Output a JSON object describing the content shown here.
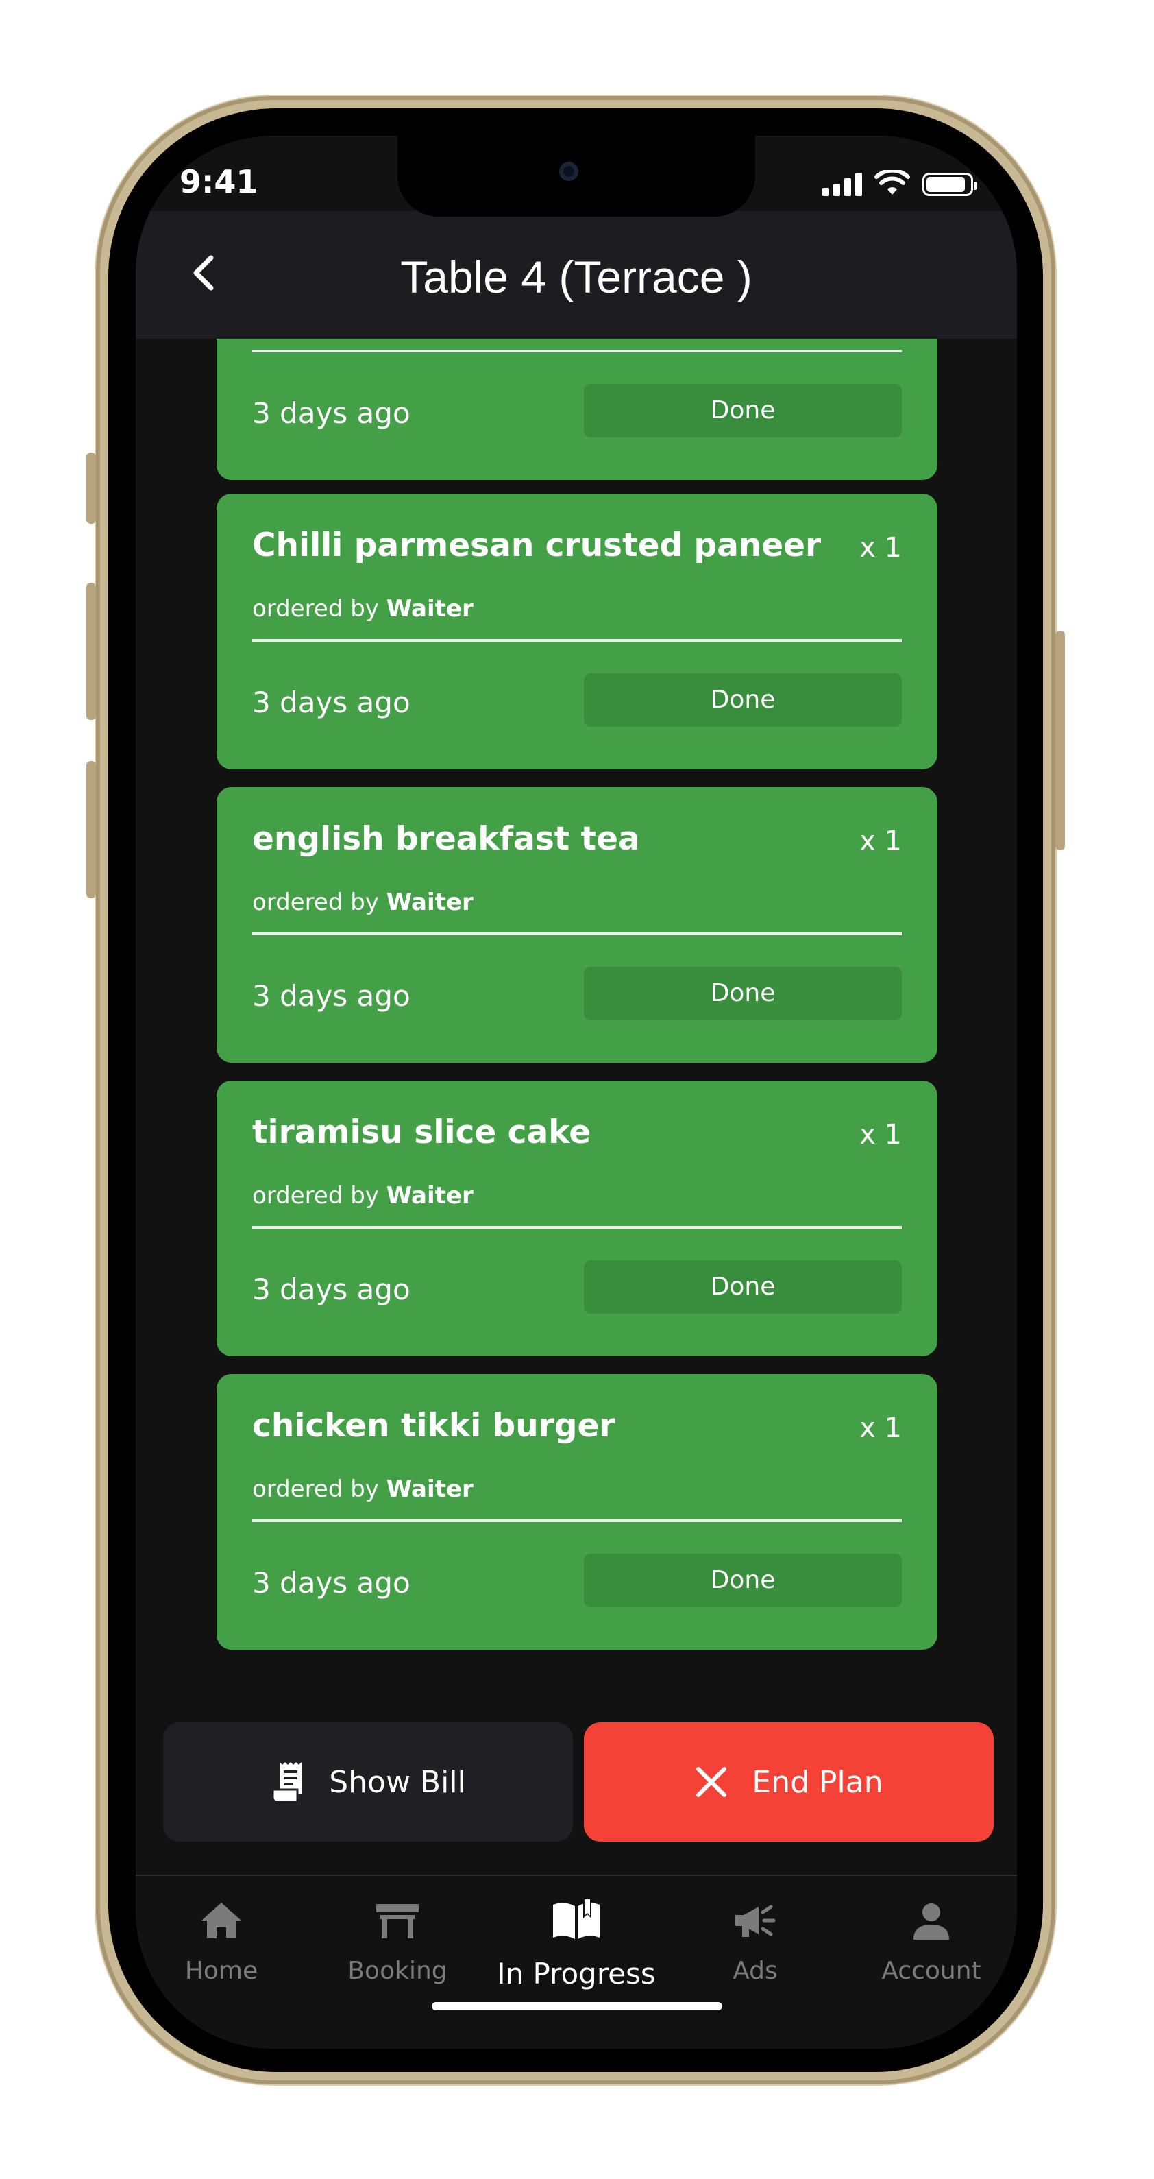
{
  "status_bar": {
    "time": "9:41"
  },
  "header": {
    "title": "Table 4  (Terrace )"
  },
  "orders": [
    {
      "item": "",
      "qty": "",
      "ordered_by_prefix": "",
      "ordered_by": "",
      "time_ago": "3 days ago",
      "status_label": "Done"
    },
    {
      "item": "Chilli parmesan crusted paneer",
      "qty": "x 1",
      "ordered_by_prefix": "ordered by",
      "ordered_by": "Waiter",
      "time_ago": "3 days ago",
      "status_label": "Done"
    },
    {
      "item": "english breakfast tea",
      "qty": "x 1",
      "ordered_by_prefix": "ordered by",
      "ordered_by": "Waiter",
      "time_ago": "3 days ago",
      "status_label": "Done"
    },
    {
      "item": "tiramisu slice cake",
      "qty": "x 1",
      "ordered_by_prefix": "ordered by",
      "ordered_by": "Waiter",
      "time_ago": "3 days ago",
      "status_label": "Done"
    },
    {
      "item": "chicken tikki burger",
      "qty": "x 1",
      "ordered_by_prefix": "ordered by",
      "ordered_by": "Waiter",
      "time_ago": "3 days ago",
      "status_label": "Done"
    }
  ],
  "actions": {
    "show_bill": {
      "label": "Show Bill",
      "icon": "receipt-icon"
    },
    "end_plan": {
      "label": "End Plan",
      "icon": "close-icon"
    }
  },
  "tabs": [
    {
      "label": "Home",
      "icon": "home-icon",
      "active": false
    },
    {
      "label": "Booking",
      "icon": "table-icon",
      "active": false
    },
    {
      "label": "In Progress",
      "icon": "open-book-icon",
      "active": true
    },
    {
      "label": "Ads",
      "icon": "megaphone-icon",
      "active": false
    },
    {
      "label": "Account",
      "icon": "person-icon",
      "active": false
    }
  ],
  "colors": {
    "card_green": "#43a047",
    "done_button": "#388e3c",
    "end_plan_red": "#f44336",
    "background": "#121212",
    "header": "#1c1c21"
  }
}
